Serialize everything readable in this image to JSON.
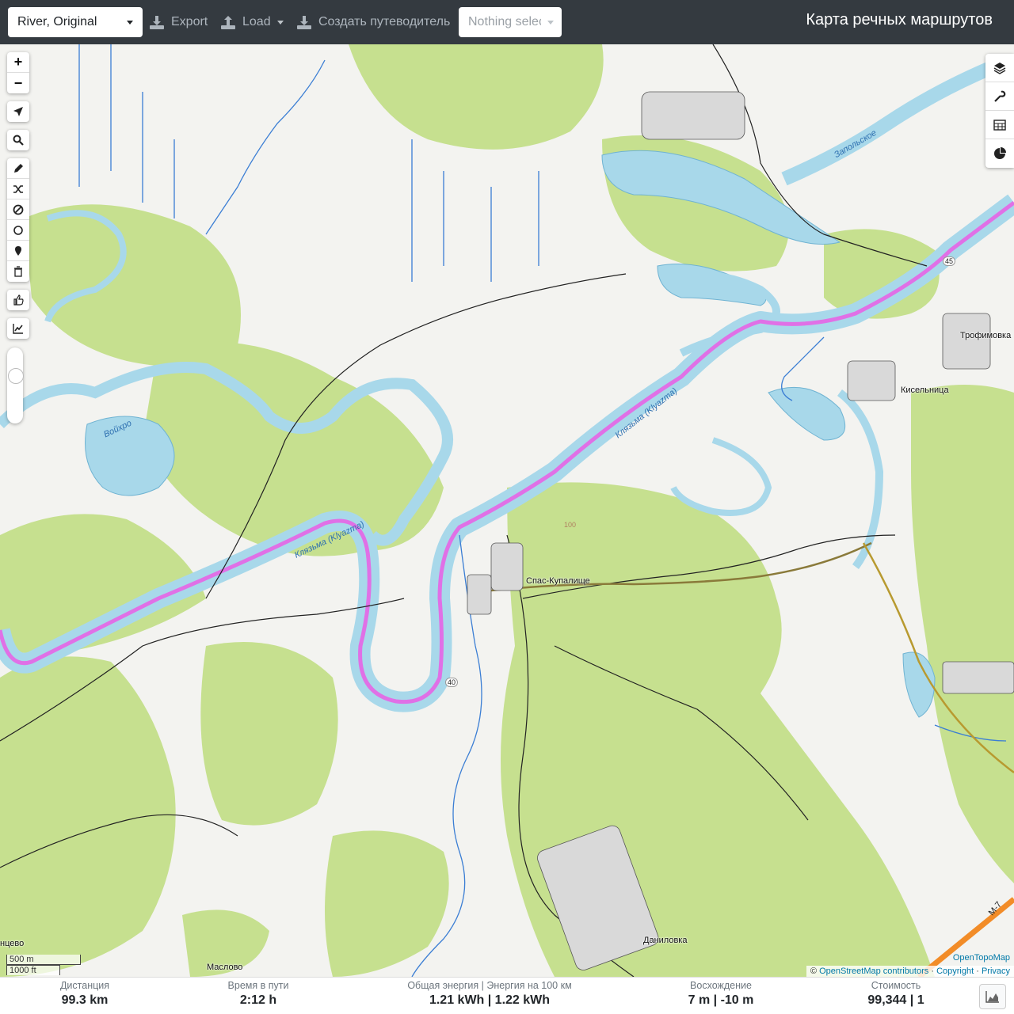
{
  "toolbar": {
    "profile": "River, Original",
    "export": "Export",
    "load": "Load",
    "guide": "Создать путеводитель",
    "selection": "Nothing selected",
    "title": "Карта речных маршрутов"
  },
  "map": {
    "labels": {
      "voikhro": "Войхро",
      "klyazma1": "Клязьма",
      "klyazma1_lat": "(Klyazma)",
      "klyazma2": "Клязьма",
      "klyazma2_lat": "(Klyazma)",
      "zapolskoe": "Запольское",
      "trofimovka": "Трофимовка",
      "kiselnitsa": "Кисельница",
      "spas": "Спас-Купалище",
      "danilovka": "Даниловка",
      "maslovo": "Маслово",
      "ntsevo": "нцево",
      "m7": "М-7",
      "road45": "45",
      "road40": "40",
      "contour100": "100"
    },
    "scale": {
      "metric": "500 m",
      "imperial": "1000 ft"
    },
    "attribution": {
      "opentopomap": "OpenTopoMap",
      "prefix": "©",
      "osm": "OpenStreetMap contributors",
      "sep": "·",
      "copyright": "Copyright",
      "privacy": "Privacy"
    },
    "zoom_in": "+",
    "zoom_out": "−"
  },
  "stats": {
    "distance": {
      "label": "Дистанция",
      "value": "99.3 km"
    },
    "time": {
      "label": "Время в пути",
      "value": "2:12 h"
    },
    "energy": {
      "label": "Общая энергия | Энергия на 100 км",
      "value": "1.21 kWh | 1.22 kWh"
    },
    "ascent": {
      "label": "Восхождение",
      "value": "7 m | -10 m"
    },
    "cost": {
      "label": "Стоимость",
      "value": "99,344 | 1"
    }
  },
  "colors": {
    "topbar": "#343a40",
    "forest": "#c6e08f",
    "water": "#a8d8ea",
    "route": "#e070e6",
    "river_line": "#3b7ed4"
  }
}
